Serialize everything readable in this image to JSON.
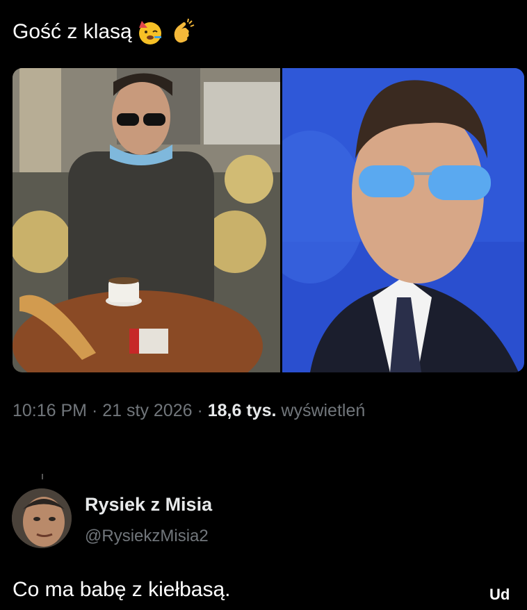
{
  "tweet": {
    "text": "Gość z klasą",
    "emojis": [
      "partying-face-emoji",
      "clapping-hands-emoji"
    ],
    "time": "10:16 PM",
    "date": "21 sty 2026",
    "views_count": "18,6 tys.",
    "views_label": "wyświetleń"
  },
  "reply": {
    "name": "Rysiek z Misia",
    "handle": "@RysiekzMisia2",
    "text": "Co ma babę z kiełbasą.",
    "cut_text": "Ud"
  },
  "colors": {
    "background": "#000000",
    "secondary_text": "#71767b",
    "primary_text": "#e7e9ea"
  }
}
